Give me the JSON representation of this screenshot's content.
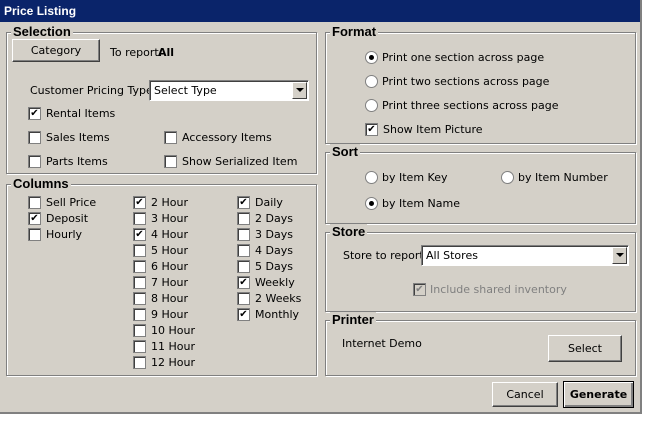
{
  "window": {
    "title": "Price Listing"
  },
  "selection": {
    "title": "Selection",
    "category_button": "Category",
    "to_report_label": "To report:",
    "to_report_value": "All",
    "pricing_type_label": "Customer Pricing Type:",
    "pricing_type_value": "Select Type",
    "rental_items": {
      "label": "Rental Items",
      "checked": true
    },
    "sales_items": {
      "label": "Sales Items",
      "checked": false
    },
    "accessory_items": {
      "label": "Accessory Items",
      "checked": false
    },
    "parts_items": {
      "label": "Parts Items",
      "checked": false
    },
    "show_serialized": {
      "label": "Show  Serialized Item",
      "checked": false
    }
  },
  "columns": {
    "title": "Columns",
    "items": [
      {
        "label": "Sell Price",
        "checked": false
      },
      {
        "label": "Deposit",
        "checked": true
      },
      {
        "label": "Hourly",
        "checked": false
      },
      {
        "label": "2 Hour",
        "checked": true
      },
      {
        "label": "3 Hour",
        "checked": false
      },
      {
        "label": "4 Hour",
        "checked": true
      },
      {
        "label": "5 Hour",
        "checked": false
      },
      {
        "label": "6 Hour",
        "checked": false
      },
      {
        "label": "7 Hour",
        "checked": false
      },
      {
        "label": "8 Hour",
        "checked": false
      },
      {
        "label": "9 Hour",
        "checked": false
      },
      {
        "label": "10 Hour",
        "checked": false
      },
      {
        "label": "11 Hour",
        "checked": false
      },
      {
        "label": "12 Hour",
        "checked": false
      },
      {
        "label": "Daily",
        "checked": true
      },
      {
        "label": "2 Days",
        "checked": false
      },
      {
        "label": "3 Days",
        "checked": false
      },
      {
        "label": "4 Days",
        "checked": false
      },
      {
        "label": "5 Days",
        "checked": false
      },
      {
        "label": "Weekly",
        "checked": true
      },
      {
        "label": "2 Weeks",
        "checked": false
      },
      {
        "label": "Monthly",
        "checked": true
      }
    ]
  },
  "format": {
    "title": "Format",
    "options": [
      {
        "label": "Print one section across page",
        "selected": true
      },
      {
        "label": "Print two sections across page",
        "selected": false
      },
      {
        "label": "Print three sections across page",
        "selected": false
      }
    ],
    "show_picture": {
      "label": "Show Item Picture",
      "checked": true
    }
  },
  "sort": {
    "title": "Sort",
    "options": [
      {
        "label": "by Item Key",
        "selected": false
      },
      {
        "label": "by Item Number",
        "selected": false
      },
      {
        "label": "by Item Name",
        "selected": true
      }
    ]
  },
  "store": {
    "title": "Store",
    "store_label": "Store to report:",
    "store_value": "All Stores",
    "include_shared": {
      "label": "Include shared inventory",
      "checked": true,
      "disabled": true
    }
  },
  "printer": {
    "title": "Printer",
    "printer_name": "Internet Demo",
    "select_button": "Select"
  },
  "footer": {
    "cancel_button": "Cancel",
    "generate_button": "Generate"
  },
  "check_mark": "✔"
}
